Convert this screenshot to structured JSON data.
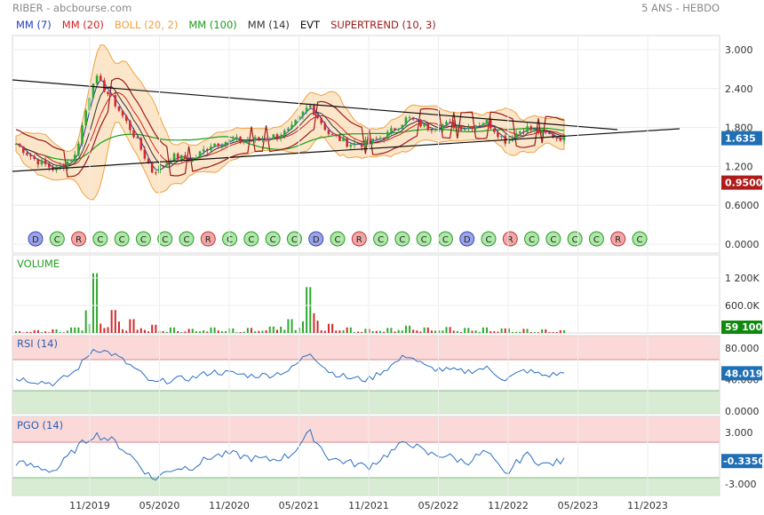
{
  "header": {
    "title": "RIBER - abcbourse.com",
    "period": "5 ANS - HEBDO"
  },
  "indicators": [
    {
      "label": "MM (7)",
      "color": "#1f3fbf"
    },
    {
      "label": "MM (20)",
      "color": "#d42020"
    },
    {
      "label": "BOLL (20, 2)",
      "color": "#f0a040"
    },
    {
      "label": "MM (100)",
      "color": "#16a016"
    },
    {
      "label": "MM (14)",
      "color": "#333333"
    },
    {
      "label": "EVT",
      "color": "#111111"
    },
    {
      "label": "SUPERTREND (10, 3)",
      "color": "#9c1a1a"
    }
  ],
  "colors": {
    "price_badge": "#1f6fb5",
    "low_badge": "#b01c1c",
    "volume_badge": "#0f8a0f",
    "volume_up": "#2fa82f",
    "volume_down": "#d42a2a",
    "rsi_line": "#2a6fc4",
    "zone_red": "#fbd9d9",
    "zone_green": "#d7ecd3"
  },
  "badges": {
    "last_price": "1.635",
    "low_price": "0.9500",
    "last_volume": "59 100",
    "last_rsi": "48.019",
    "last_pgo": "-0.3350"
  },
  "x_axis": {
    "ticks": [
      "11/2019",
      "05/2020",
      "11/2020",
      "05/2021",
      "11/2021",
      "05/2022",
      "11/2022",
      "05/2023",
      "11/2023"
    ]
  },
  "price_panel": {
    "yticks": [
      "3.000",
      "2.400",
      "1.800",
      "1.200",
      "0.6000",
      "0.0000"
    ],
    "event_markers": [
      "D",
      "C",
      "R",
      "C",
      "C",
      "C",
      "C",
      "C",
      "R",
      "C",
      "C",
      "C",
      "C",
      "D",
      "C",
      "R",
      "C",
      "C",
      "C",
      "C",
      "D",
      "C",
      "R",
      "C",
      "C",
      "C",
      "C",
      "R",
      "C"
    ]
  },
  "volume_panel": {
    "label": "VOLUME",
    "yticks": [
      "1 200K",
      "600.0K"
    ]
  },
  "rsi_panel": {
    "label": "RSI (14)",
    "yticks": [
      "80.000",
      "40.000",
      "0.0000"
    ]
  },
  "pgo_panel": {
    "label": "PGO (14)",
    "yticks": [
      "3.000",
      "-3.000"
    ]
  },
  "chart_data": {
    "type": "line",
    "title": "RIBER - abcbourse.com",
    "period": "5 ANS - HEBDO",
    "x": [
      "2019-07",
      "2019-09",
      "2019-10",
      "2019-11",
      "2019-12",
      "2020-01",
      "2020-02",
      "2020-03",
      "2020-04",
      "2020-05",
      "2020-07",
      "2020-09",
      "2020-11",
      "2021-01",
      "2021-03",
      "2021-04",
      "2021-05",
      "2021-07",
      "2021-09",
      "2021-11",
      "2021-12",
      "2022-02",
      "2022-04",
      "2022-06",
      "2022-08",
      "2022-10",
      "2022-12",
      "2023-02",
      "2023-04"
    ],
    "series": [
      {
        "name": "Close",
        "values": [
          1.55,
          1.3,
          1.15,
          1.35,
          2.6,
          2.2,
          1.7,
          1.1,
          1.35,
          1.3,
          1.55,
          1.6,
          1.6,
          1.65,
          1.75,
          2.15,
          1.7,
          1.55,
          1.55,
          1.7,
          1.95,
          1.8,
          1.85,
          1.8,
          1.9,
          1.6,
          1.8,
          1.7,
          1.635
        ]
      }
    ],
    "ylim": [
      0,
      3.3
    ],
    "volume": {
      "values": [
        40,
        60,
        80,
        120,
        1300,
        500,
        300,
        180,
        120,
        90,
        120,
        100,
        110,
        140,
        300,
        1000,
        200,
        120,
        90,
        110,
        160,
        120,
        130,
        110,
        120,
        100,
        90,
        80,
        59.1
      ],
      "unit": "K"
    },
    "rsi": {
      "values": [
        42,
        38,
        35,
        50,
        80,
        72,
        55,
        35,
        40,
        42,
        50,
        48,
        45,
        46,
        52,
        75,
        50,
        42,
        40,
        55,
        72,
        55,
        52,
        50,
        55,
        40,
        52,
        45,
        48.019
      ],
      "ylim": [
        0,
        100
      ],
      "zones": [
        80,
        40
      ]
    },
    "pgo": {
      "values": [
        -0.5,
        -1,
        -1.5,
        1,
        2.8,
        2,
        0,
        -2.5,
        -1.2,
        -1,
        0.2,
        0.5,
        0,
        -0.2,
        0.3,
        3,
        0,
        -0.5,
        -1,
        0.5,
        2,
        0.5,
        0.3,
        -0.5,
        0.8,
        -2,
        0.5,
        -0.8,
        -0.335
      ],
      "ylim": [
        -4,
        4
      ],
      "zones": [
        2,
        -2
      ]
    }
  }
}
